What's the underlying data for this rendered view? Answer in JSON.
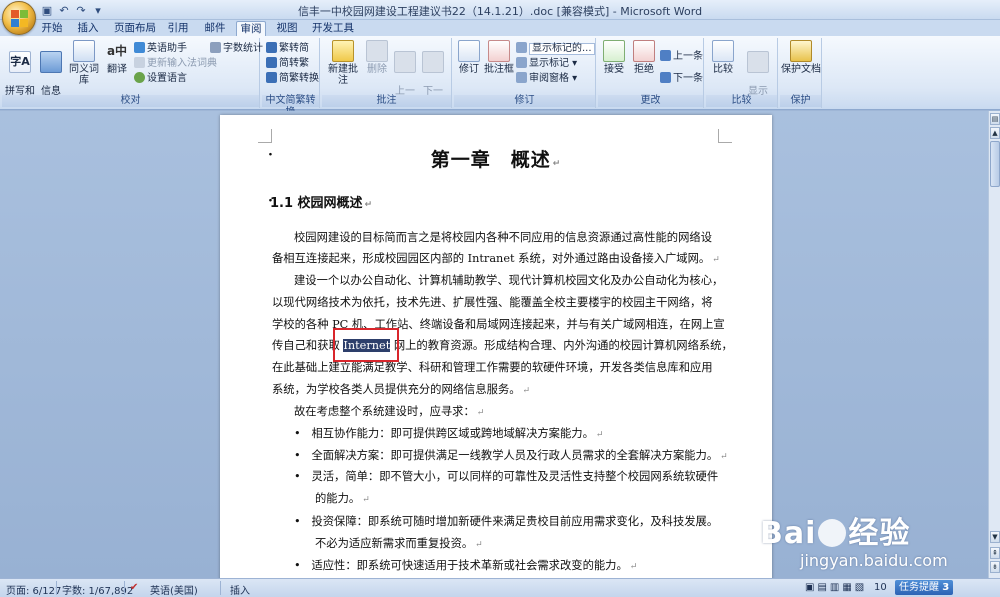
{
  "window": {
    "title": "信丰一中校园网建设工程建议书22（14.1.21）.doc [兼容模式] - Microsoft Word"
  },
  "tabs": [
    "开始",
    "插入",
    "页面布局",
    "引用",
    "邮件",
    "审阅",
    "视图",
    "开发工具"
  ],
  "active_tab": "审阅",
  "ribbon": {
    "proofing": {
      "label": "校对",
      "spelling": "拼写和\n语法",
      "research": "信息\n检索",
      "thesaurus": "同义词库",
      "translate": "翻译",
      "english_assistant": "英语助手",
      "update_ime": "更新输入法词典",
      "set_language": "设置语言",
      "word_count": "字数统计"
    },
    "chinese": {
      "label": "中文简繁转换",
      "to_simplified": "繁转简",
      "to_traditional": "简转繁",
      "convert": "简繁转换"
    },
    "comments": {
      "label": "批注",
      "new": "新建批注",
      "delete": "删除",
      "previous": "上一\n条",
      "next": "下一\n条"
    },
    "tracking": {
      "label": "修订",
      "track": "修订",
      "balloons": "批注框",
      "display_select": "显示标记的...",
      "show_markup": "显示标记",
      "reviewing_pane": "审阅窗格"
    },
    "changes": {
      "label": "更改",
      "accept": "接受",
      "reject": "拒绝",
      "previous": "上一条",
      "next": "下一条"
    },
    "compare": {
      "label": "比较",
      "compare": "比较",
      "show_source": "显示\n源文档"
    },
    "protect": {
      "label": "保护",
      "protect_doc": "保护文档"
    }
  },
  "document": {
    "chapter_title": "第一章　概述",
    "section_title": "1.1  校园网概述",
    "lines": [
      "校园网建设的目标简而言之是将校园内各种不同应用的信息资源通过高性能的网络设",
      "备相互连接起来，形成校园园区内部的 Intranet 系统，对外通过路由设备接入广域网。",
      "建设一个以办公自动化、计算机辅助教学、现代计算机校园文化及办公自动化为核心，",
      "以现代网络技术为依托，技术先进、扩展性强、能覆盖全校主要楼宇的校园主干网络，将",
      "学校的各种 PC 机、工作站、终端设备和局域网连接起来，并与有关广域网相连，在网上宣",
      "在此基础上建立能满足教学、科研和管理工作需要的软硬件环境，开发各类信息库和应用",
      "系统，为学校各类人员提供充分的网络信息服务。",
      "故在考虑整个系统建设时，应寻求："
    ],
    "selected_line": {
      "before": "传自己和获取 ",
      "selected": "Internet",
      "after": " 网上的教育资源。形成结构合理、内外沟通的校园计算机网络系统，"
    },
    "bullets": [
      "相互协作能力：即可提供跨区域或跨地域解决方案能力。",
      "全面解决方案：即可提供满足一线教学人员及行政人员需求的全套解决方案能力。",
      "灵活，简单：即不管大小，可以同样的可靠性及灵活性支持整个校园网系统软硬件",
      "的能力。",
      "投资保障：即系统可随时增加新硬件来满足贵校目前应用需求变化，及科技发展。",
      "不必为适应新需求而重复投资。",
      "适应性：即系统可快速适用于技术革新或社会需求改变的能力。"
    ],
    "paragraph_mark": "↵"
  },
  "status": {
    "page": "页面: 6/127",
    "words": "字数: 1/67,892",
    "language": "英语(美国)",
    "mode": "插入",
    "zoom": "10",
    "taskbar": "任务提醒",
    "taskbar_count": "3"
  },
  "watermark": {
    "logo": "Bai",
    "logo_suffix": "经验",
    "url": "jingyan.baidu.com"
  },
  "colors": {
    "ribbon_bg": "#dde8f6",
    "selection": "#2d3f6b",
    "highlight_box": "#d9262c"
  }
}
